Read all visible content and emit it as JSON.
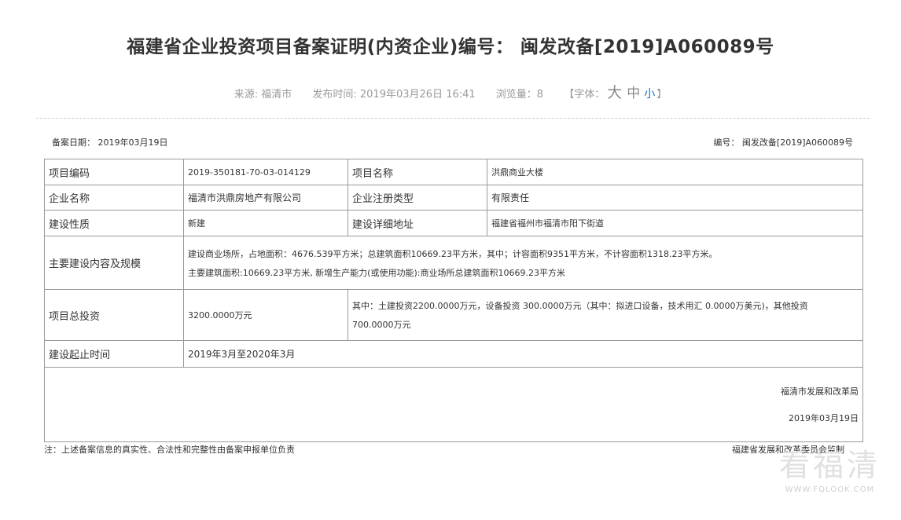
{
  "header": {
    "title": "福建省企业投资项目备案证明(内资企业)编号： 闽发改备[2019]A060089号",
    "source": "来源: 福清市",
    "published": "发布时间: 2019年03月26日 16:41",
    "views": "浏览量：8",
    "font_open": "【字体：",
    "font_large": "大",
    "font_medium": "中",
    "font_small": "小",
    "font_close": "】"
  },
  "record": {
    "date": "备案日期： 2019年03月19日",
    "number": "编号： 闽发改备[2019]A060089号"
  },
  "table": {
    "project_code_label": "项目编码",
    "project_code": "2019-350181-70-03-014129",
    "project_name_label": "项目名称",
    "project_name": "洪鼎商业大楼",
    "company_label": "企业名称",
    "company": "福清市洪鼎房地产有限公司",
    "reg_type_label": "企业注册类型",
    "reg_type": "有限责任",
    "nature_label": "建设性质",
    "nature": "新建",
    "address_label": "建设详细地址",
    "address": "福建省福州市福清市阳下街道",
    "scope_label": "主要建设内容及规模",
    "scope_line1": "建设商业场所，占地面积：4676.539平方米；总建筑面积10669.23平方米，其中；计容面积9351平方米，不计容面积1318.23平方米。",
    "scope_line2": "主要建筑面积:10669.23平方米, 新增生产能力(或使用功能):商业场所总建筑面积10669.23平方米",
    "investment_label": "项目总投资",
    "investment": "3200.0000万元",
    "investment_detail_1": "其中：土建投资2200.0000万元，设备投资 300.0000万元（其中：拟进口设备，技术用汇 0.0000万美元)，其他投资",
    "investment_detail_2": "700.0000万元",
    "period_label": "建设起止时间",
    "period": "2019年3月至2020年3月",
    "issuer": "福清市发展和改革局",
    "issue_date": "2019年03月19日"
  },
  "footer": {
    "note": "注：上述备案信息的真实性、合法性和完整性由备案申报单位负责",
    "supervisor": "福建省发展和改革委员会监制"
  },
  "watermark": {
    "logo": "看福清",
    "url": "WWW.FQLOOK.COM"
  }
}
